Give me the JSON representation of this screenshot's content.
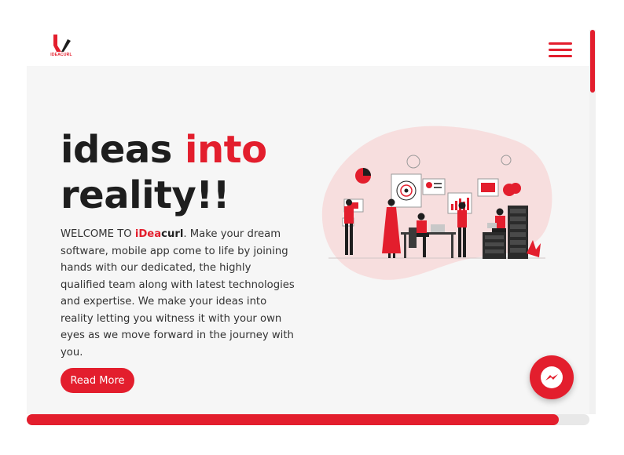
{
  "brand": {
    "logo_text": "IDEACURL",
    "accent": "#e31e2d"
  },
  "header": {
    "menu_icon": "hamburger-menu-icon"
  },
  "hero": {
    "headline_part1": "ideas ",
    "headline_part2": "into",
    "headline_part3": "reality!!",
    "intro_prefix": "WELCOME TO ",
    "brand_red": "iDea",
    "brand_dark": "curl",
    "intro_body": ". Make your dream software, mobile app come to life by joining hands with our dedicated, the highly qualified team along with latest technologies and expertise. We make your ideas into reality letting you witness it with your own eyes as we move forward in the journey with you.",
    "read_more_label": "Read More",
    "illustration_icon": "team-analytics-illustration"
  },
  "widgets": {
    "messenger_icon": "messenger-icon"
  },
  "progress": {
    "fraction": 0.945
  }
}
